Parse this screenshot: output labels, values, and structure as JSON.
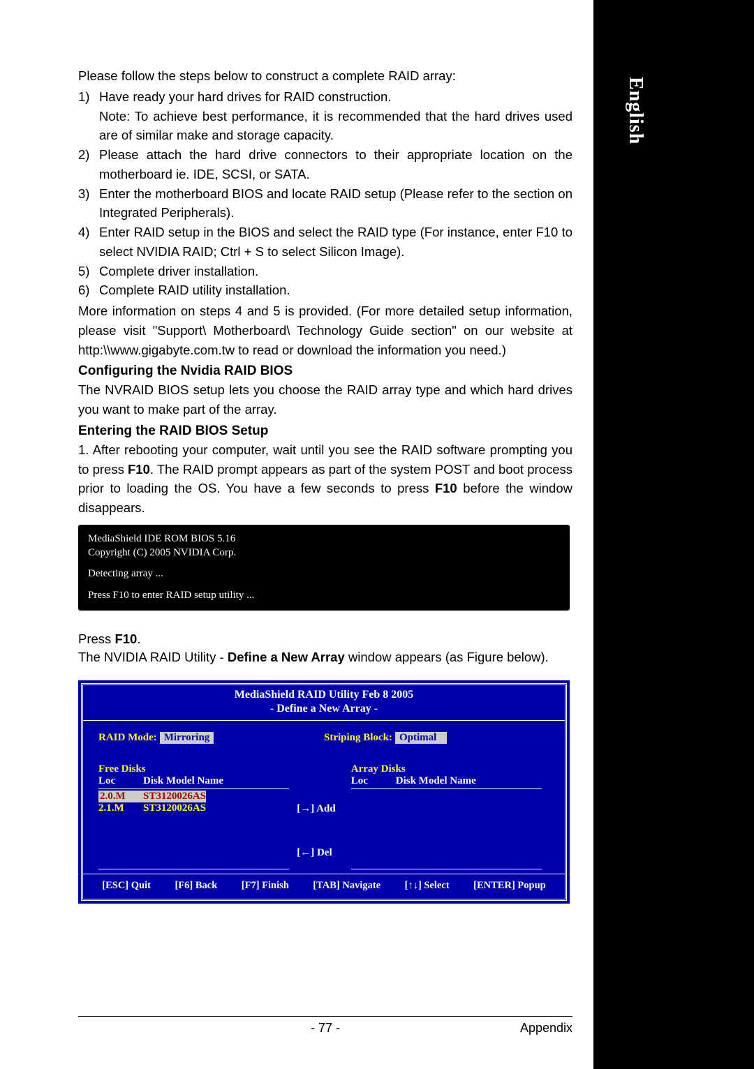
{
  "side_tab": "English",
  "intro": "Please follow the steps below to construct a complete RAID array:",
  "steps": [
    {
      "num": "1)",
      "text": "Have ready your hard drives for RAID construction.\nNote: To achieve best performance, it is recommended that the hard drives used are of similar make and storage capacity."
    },
    {
      "num": "2)",
      "text": "Please attach the hard drive connectors to their appropriate location on the motherboard ie. IDE, SCSI, or SATA."
    },
    {
      "num": "3)",
      "text": "Enter the motherboard BIOS and locate RAID setup (Please refer to the section on Integrated Peripherals)."
    },
    {
      "num": "4)",
      "text": "Enter RAID setup in the BIOS and select the RAID type (For instance, enter F10 to select NVIDIA RAID; Ctrl + S to select Silicon Image)."
    },
    {
      "num": "5)",
      "text": "Complete driver installation."
    },
    {
      "num": "6)",
      "text": "Complete RAID utility installation."
    }
  ],
  "more_info": "More information on steps 4 and 5 is provided. (For more detailed setup information, please visit \"Support\\ Motherboard\\ Technology Guide section\" on our website at http:\\\\www.gigabyte.com.tw to read or download the information you need.)",
  "heading1": "Configuring the Nvidia RAID BIOS",
  "heading1_text": "The NVRAID BIOS setup lets you choose the RAID array type and which hard drives you want to make part of the array.",
  "heading2": "Entering the RAID BIOS Setup",
  "heading2_text_prefix": "1. After rebooting your computer, wait until you see the RAID software prompting you to press ",
  "heading2_bold1": "F10",
  "heading2_text_mid": ". The RAID prompt appears as part of the system POST and boot process prior to loading the OS. You have a few seconds to press ",
  "heading2_bold2": "F10",
  "heading2_text_suffix": " before the window disappears.",
  "terminal": {
    "line1": "MediaShield IDE ROM BIOS 5.16",
    "line2": "Copyright (C) 2005 NVIDIA Corp.",
    "line3": "Detecting array ...",
    "line4": "Press F10 to enter RAID setup utility ..."
  },
  "press_prefix": "Press ",
  "press_bold": "F10",
  "press_suffix": ".",
  "below_prefix": "The NVIDIA RAID Utility - ",
  "below_bold": "Define a New Array",
  "below_suffix": " window appears (as Figure below).",
  "raid": {
    "title1": "MediaShield RAID Utility  Feb 8 2005",
    "title2": "- Define a New Array -",
    "mode_label": "RAID Mode:",
    "mode_value": "Mirroring",
    "stripe_label": "Striping Block:",
    "stripe_value": "Optimal",
    "free_label": "Free Disks",
    "array_label": "Array Disks",
    "col_loc": "Loc",
    "col_model": "Disk Model Name",
    "free_disks": [
      {
        "loc": "2.0.M",
        "name": "ST3120026AS",
        "selected": true
      },
      {
        "loc": "2.1.M",
        "name": "ST3120026AS",
        "selected": false
      }
    ],
    "add_label": "[→] Add",
    "del_label": "[←]  Del",
    "keys": [
      "[ESC] Quit",
      "[F6] Back",
      "[F7] Finish",
      "[TAB] Navigate",
      "[↑↓] Select",
      "[ENTER] Popup"
    ]
  },
  "footer": {
    "page": "- 77 -",
    "section": "Appendix"
  }
}
